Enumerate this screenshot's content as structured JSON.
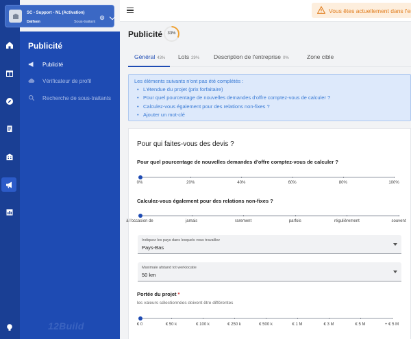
{
  "org": {
    "name": "SC - Support - NL (Activation)",
    "sub": "Dalfsen",
    "role": "Sous-traitant"
  },
  "rail": {
    "items": [
      {
        "icon": "home-icon"
      },
      {
        "icon": "table-icon"
      },
      {
        "icon": "compass-icon"
      },
      {
        "icon": "clipboard-icon"
      },
      {
        "icon": "building-icon"
      },
      {
        "icon": "megaphone-icon",
        "active": true
      },
      {
        "icon": "chart-icon"
      },
      {
        "icon": "lightbulb-icon"
      }
    ]
  },
  "subnav": {
    "title": "Publicité",
    "items": [
      {
        "label": "Publicité",
        "icon": "megaphone-icon",
        "active": true
      },
      {
        "label": "Vérificateur de profil",
        "icon": "cloud-icon"
      },
      {
        "label": "Recherche de sous-traitants",
        "icon": "search-icon"
      }
    ],
    "brand": "12Build"
  },
  "topbar": {
    "alert": "Vous êtes actuellement dans l'en"
  },
  "page": {
    "title": "Publicité",
    "progress_pct": 33,
    "progress_label": "33%"
  },
  "tabs": [
    {
      "label": "Général",
      "pct": "43%",
      "active": true
    },
    {
      "label": "Lots",
      "pct": "29%"
    },
    {
      "label": "Description de l'entreprise",
      "pct": "0%"
    },
    {
      "label": "Zone cible",
      "pct": ""
    }
  ],
  "info": {
    "heading": "Les éléments suivants n'ont pas été complétés :",
    "items": [
      "L'étendue du projet (prix forfaitaire)",
      "Pour quel pourcentage de nouvelles demandes d'offre comptez-vous de calculer ?",
      "Calculez-vous également pour des relations non-fixes ?",
      "Ajouter un mot-clé"
    ]
  },
  "form": {
    "section_title": "Pour qui faites-vous des devis ?",
    "q1": "Pour quel pourcentage de nouvelles demandes d'offre comptez-vous de calculer ?",
    "slider1": {
      "labels": [
        "0%",
        "20%",
        "40%",
        "60%",
        "80%",
        "100%"
      ],
      "value_index": 0
    },
    "q2": "Calculez-vous également pour des relations non-fixes ?",
    "slider2": {
      "labels": [
        "à l'occasion de",
        "jamais",
        "rarement",
        "parfois",
        "régulièrement",
        "souvent"
      ],
      "value_index": 0
    },
    "select1": {
      "label": "Indiquez les pays dans lesquels vous travaillez",
      "value": "Pays-Bas"
    },
    "select2": {
      "label": "Maximale afstand tot werklocatie",
      "value": "50 km"
    },
    "q3": "Portée du projet",
    "q3_required": "*",
    "q3_hint": "les valeurs sélectionnées doivent être différentes",
    "slider3": {
      "labels": [
        "€ 0",
        "€ 50 k",
        "€ 100 k",
        "€ 250 k",
        "€ 500 k",
        "€ 1 M",
        "€ 3 M",
        "€ 5 M",
        "+ € 5 M"
      ],
      "value_index": 0
    }
  },
  "colors": {
    "rail": "#1a3f94",
    "subnav": "#1e4bb3",
    "accent": "#1e4bb3",
    "info_bg": "#dde9fb",
    "info_text": "#3a7bd5",
    "alert_bg": "#fdeedd",
    "alert_text": "#e07c1c",
    "progress": "#f0a030"
  }
}
